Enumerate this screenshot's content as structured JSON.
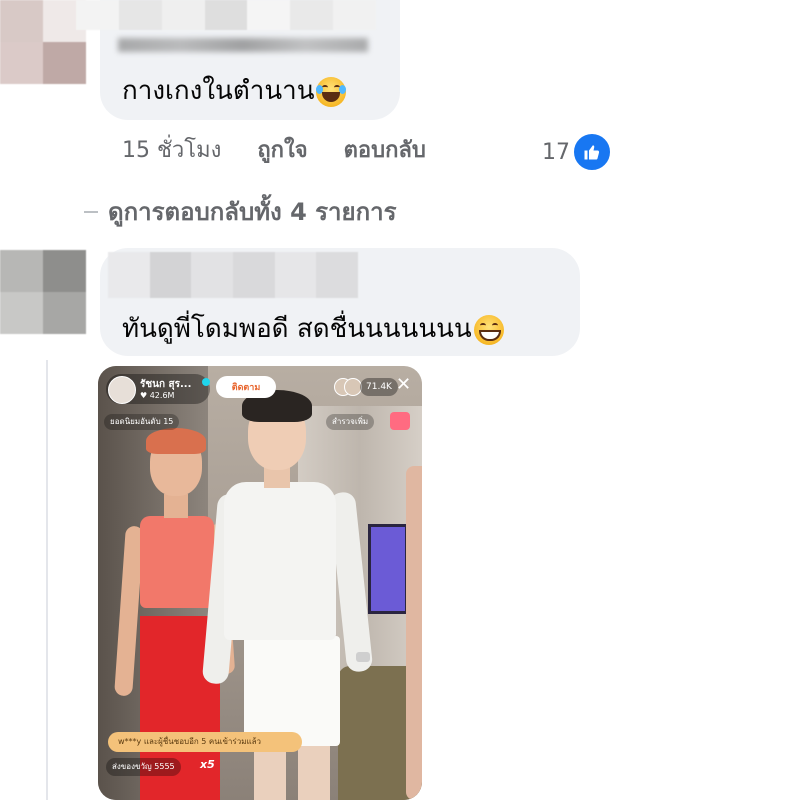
{
  "comment1": {
    "author_blurred": "",
    "text": "กางเกงในตำนาน",
    "emoji": "laughing-crying-emoji",
    "time": "15 ชั่วโมง",
    "like_label": "ถูกใจ",
    "reply_label": "ตอบกลับ",
    "like_count": "17",
    "view_replies_label": "ดูการตอบกลับทั้ง 4 รายการ"
  },
  "comment2": {
    "author_blurred": "",
    "text": "ทันดูพี่โดมพอดี สดชื่นนนนนนน",
    "emoji": "grinning-emoji"
  },
  "live_overlay": {
    "host_name": "รัชนก สุร...",
    "host_likes": "♥ 42.6M",
    "follow_label": "ติดตาม",
    "viewer_count": "71.4K",
    "close": "✕",
    "rank_label": "ยอดนิยมอันดับ 15",
    "explore_label": "สำรวจเพิ่ม",
    "join_banner": "w***y และผู้ชื่นชอบอีก 5 คนเข้าร่วมแล้ว",
    "gift_text": "ส่งของขวัญ 5555",
    "gift_multiplier": "x5"
  },
  "colors": {
    "bubble_bg": "#f0f2f5",
    "meta_text": "#65676b",
    "like_blue": "#1877f2",
    "thread_line": "#e4e6eb"
  },
  "avatar1_pixels": [
    "#d8c9c6",
    "#efe9e8",
    "#dbcac8",
    "#bfa9a6"
  ],
  "avatar2_pixels": [
    "#b7b7b5",
    "#8e8e8c",
    "#c8c8c6",
    "#a7a7a5"
  ],
  "name1_pixels": [
    "#f3f3f3",
    "#e6e6e6",
    "#efefef",
    "#dedede",
    "#f5f5f5",
    "#e9e9e9",
    "#f1f1f1"
  ],
  "name2_pixels": [
    "#e9e9eb",
    "#d3d3d5",
    "#e2e2e4",
    "#d9d9db",
    "#e6e6e8",
    "#dcdcde"
  ]
}
